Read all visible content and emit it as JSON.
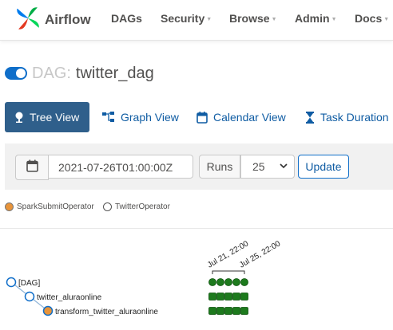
{
  "nav": {
    "brand": "Airflow",
    "items": [
      "DAGs",
      "Security",
      "Browse",
      "Admin",
      "Docs"
    ],
    "dropdown_items": [
      false,
      true,
      true,
      true,
      true
    ]
  },
  "dag": {
    "prefix": "DAG:",
    "name": "twitter_dag",
    "toggle_on": true
  },
  "tabs": [
    {
      "label": "Tree View",
      "icon": "tree-icon",
      "active": true
    },
    {
      "label": "Graph View",
      "icon": "graph-icon",
      "active": false
    },
    {
      "label": "Calendar View",
      "icon": "calendar-icon",
      "active": false
    },
    {
      "label": "Task Duration",
      "icon": "hourglass-icon",
      "active": false
    }
  ],
  "filters": {
    "base_date": "2021-07-26T01:00:00Z",
    "runs_label": "Runs",
    "runs_value": "25",
    "update_label": "Update"
  },
  "legend": [
    {
      "label": "SparkSubmitOperator",
      "color": "#e8943a"
    },
    {
      "label": "TwitterOperator",
      "color": "#ffffff"
    }
  ],
  "tree": {
    "date_labels": [
      "Jul 21, 22:00",
      "Jul 25, 22:00"
    ],
    "nodes": [
      {
        "label": "[DAG]",
        "depth": 0,
        "fill": "#ffffff",
        "stroke": "#0f6ec9"
      },
      {
        "label": "twitter_aluraonline",
        "depth": 1,
        "fill": "#ffffff",
        "stroke": "#0f6ec9"
      },
      {
        "label": "transform_twitter_aluraonline",
        "depth": 2,
        "fill": "#e8943a",
        "stroke": "#0f6ec9"
      }
    ],
    "run_count": 5,
    "status_color": "#1d7a1d",
    "status": "success"
  },
  "colors": {
    "accent": "#0f6ec9",
    "active_tab": "#2f5f8b",
    "success": "#1d7a1d"
  }
}
